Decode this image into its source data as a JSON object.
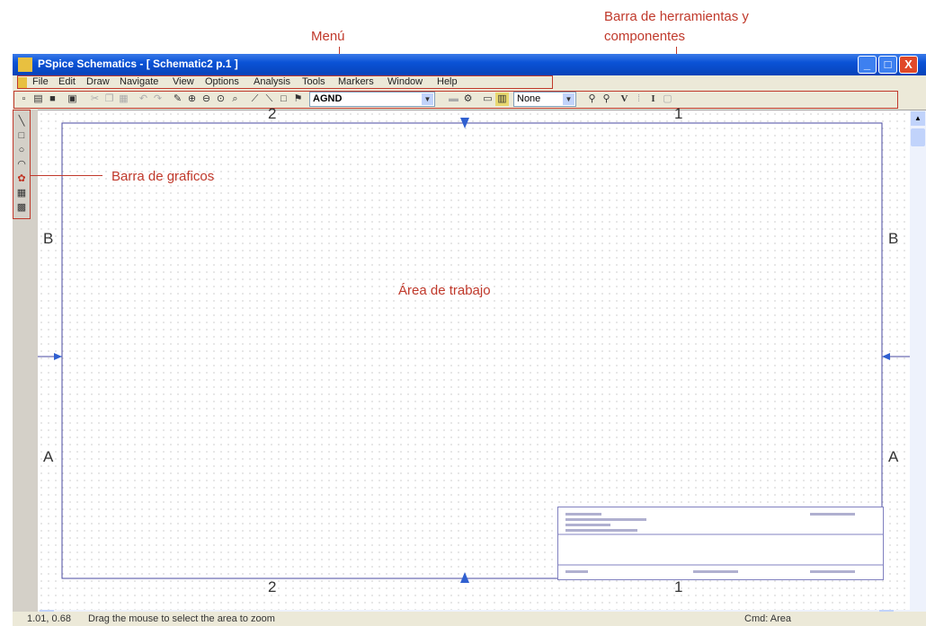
{
  "annotations": {
    "menu": "Menú",
    "toolbar": "Barra de herramientas y componentes",
    "toolbar_line1": "Barra de herramientas y",
    "toolbar_line2": "componentes",
    "graphics": "Barra de graficos",
    "workarea": "Área de trabajo"
  },
  "window": {
    "title": "PSpice Schematics - [ Schematic2  p.1  ]",
    "controls": {
      "minimize": "_",
      "maximize": "□",
      "close": "X"
    }
  },
  "menu": [
    "File",
    "Edit",
    "Draw",
    "Navigate",
    "View",
    "Options",
    "Analysis",
    "Tools",
    "Markers",
    "Window",
    "Help"
  ],
  "toolbar": {
    "part_combo": "AGND",
    "marker_combo": "None",
    "v_label": "V",
    "i_label": "I"
  },
  "sheet": {
    "zones_top": [
      "2",
      "1"
    ],
    "zones_bottom": [
      "2",
      "1"
    ],
    "zones_side": [
      "B",
      "A"
    ]
  },
  "status": {
    "coords": "1.01, 0.68",
    "message": "Drag the mouse to select the area to zoom",
    "cmd": "Cmd: Area"
  },
  "colors": {
    "annotation": "#c0392b",
    "titlebar": "#0a52d6",
    "border": "#4a4aa0"
  }
}
